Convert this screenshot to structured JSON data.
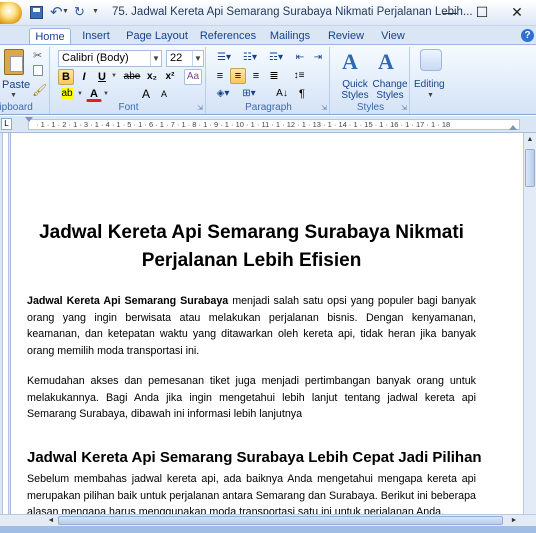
{
  "titlebar": {
    "title": "75. Jadwal Kereta Api Semarang Surabaya Nikmati Perjalanan Lebih...",
    "undo": "↶",
    "redo": "↻"
  },
  "tabs": [
    "Home",
    "Insert",
    "Page Layout",
    "References",
    "Mailings",
    "Review",
    "View"
  ],
  "ribbon": {
    "clipboard": {
      "paste_label": "Paste",
      "group_label": "Clipboard"
    },
    "font": {
      "family": "Calibri (Body)",
      "size": "22",
      "group_label": "Font",
      "bold": "B",
      "italic": "I",
      "underline": "U",
      "strike": "abe",
      "sub": "x₂",
      "sup": "x²",
      "clear": "Aa",
      "grow": "A",
      "shrink": "A"
    },
    "paragraph": {
      "group_label": "Paragraph",
      "pilcrow": "¶"
    },
    "styles": {
      "quick_label": "Quick Styles",
      "change_label": "Change Styles",
      "group_label": "Styles"
    },
    "editing": {
      "label": "Editing"
    }
  },
  "ruler": {
    "marks": "· 1 · 1 · 2 · 1 · 3 · 1 · 4 · 1 · 5 · 1 · 6 · 1 · 7 · 1 · 8 · 1 · 9 · 1 · 10 · 1 · 11 · 1 · 12 · 1 · 13 · 1 · 14 · 1 · 15 · 1 · 16 · 1 · 17 · 1 · 18"
  },
  "document": {
    "title_line1": "Jadwal Kereta Api Semarang Surabaya Nikmati",
    "title_line2": "Perjalanan Lebih Efisien",
    "p1_bold": "Jadwal Kereta Api Semarang Surabaya",
    "p1_rest": " menjadi salah satu opsi yang populer bagi banyak orang yang ingin berwisata atau melakukan perjalanan bisnis. Dengan kenyamanan, keamanan, dan ketepatan waktu yang ditawarkan oleh kereta api, tidak heran jika banyak orang memilih moda transportasi ini.",
    "p2": "Kemudahan akses dan pemesanan tiket juga menjadi pertimbangan banyak orang untuk melakukannya. Bagi Anda jika ingin mengetahui lebih lanjut tentang jadwal kereta api Semarang Surabaya, dibawah ini informasi lebih lanjutnya",
    "h2": "Jadwal Kereta Api Semarang Surabaya Lebih Cepat Jadi Pilihan",
    "p3": "Sebelum membahas jadwal kereta api, ada baiknya Anda mengetahui mengapa kereta api merupakan pilihan baik untuk perjalanan antara Semarang dan Surabaya. Berikut ini beberapa alasan mengapa harus menggunakan moda transportasi satu ini untuk perjalanan Anda."
  }
}
